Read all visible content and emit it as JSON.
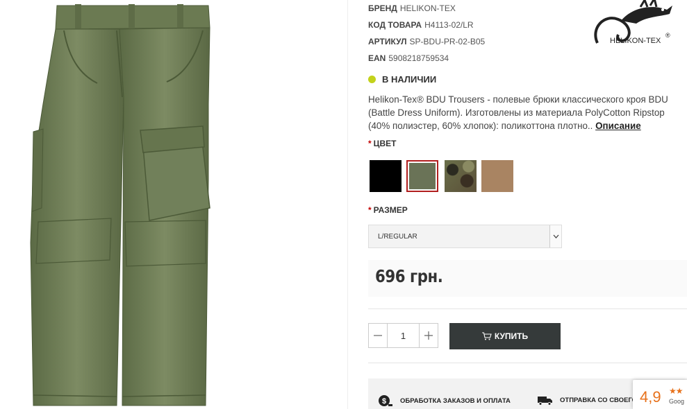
{
  "product": {
    "image_alt": "Olive green BDU trousers",
    "specs": [
      {
        "key": "БРЕНД",
        "value": "HELIKON-TEX"
      },
      {
        "key": "КОД ТОВАРА",
        "value": "H4113-02/LR"
      },
      {
        "key": "АРТИКУЛ",
        "value": "SP-BDU-PR-02-B05"
      },
      {
        "key": "EAN",
        "value": "5908218759534"
      }
    ],
    "logo_text": "HELIKON-TEX",
    "logo_mark": "®",
    "stock": "В НАЛИЧИИ",
    "description": "Helikon-Tex® BDU Trousers - полевые брюки классического кроя BDU (Battle Dress Uniform). Изготовлены из материала PolyCotton Ripstop (40% полиэстер, 60% хлопок): поликоттона плотно..",
    "description_link": "Описание",
    "color_label": "ЦВЕТ",
    "required_mark": "*",
    "colors": [
      {
        "name": "black-swatch",
        "hex": "#000000"
      },
      {
        "name": "olive-swatch",
        "hex": "#6a7357",
        "selected": true
      },
      {
        "name": "camo-swatch",
        "hex": "#6b6a4e"
      },
      {
        "name": "coyote-swatch",
        "hex": "#a98462"
      }
    ],
    "size_label": "РАЗМЕР",
    "size_value": "L/REGULAR",
    "price": "696 грн.",
    "quantity": "1",
    "buy_label": "КУПИТЬ",
    "info": [
      {
        "label": "ОБРАБОТКА ЗАКАЗОВ И ОПЛАТА"
      },
      {
        "label": "ОТПРАВКА СО СВОЕГО"
      }
    ],
    "rating": {
      "value": "4,9",
      "stars": "★★",
      "source": "Goog"
    }
  },
  "colors": {
    "accent": "#c3d21b",
    "selected_border": "#b01e1e",
    "button": "#353a3a",
    "rating": "#e7711b"
  }
}
